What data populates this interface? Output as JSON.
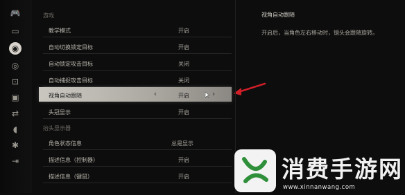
{
  "sidebar": {
    "icons": [
      {
        "name": "gamepad-icon",
        "glyph": "🎮"
      },
      {
        "name": "display-icon",
        "glyph": "▭"
      },
      {
        "name": "gameplay-icon",
        "glyph": "◉",
        "active": true
      },
      {
        "name": "eye-icon",
        "glyph": "◎"
      },
      {
        "name": "camera-icon",
        "glyph": "⊡"
      },
      {
        "name": "monitor-icon",
        "glyph": "▣"
      },
      {
        "name": "swap-icon",
        "glyph": "⇄"
      },
      {
        "name": "audio-icon",
        "glyph": "◖"
      },
      {
        "name": "accessibility-icon",
        "glyph": "✱"
      },
      {
        "name": "exit-icon",
        "glyph": "⇥"
      }
    ]
  },
  "sections": [
    {
      "header": "游戏"
    },
    {
      "header": "抬头显示器"
    }
  ],
  "settings": [
    {
      "label": "教学模式",
      "value": "开启"
    },
    {
      "label": "自动切换锁定目标",
      "value": "开启"
    },
    {
      "label": "自动锁定攻击目标",
      "value": "关闭"
    },
    {
      "label": "自动捕捉攻击目标",
      "value": "关闭"
    },
    {
      "label": "视角自动跟随",
      "value": "开启",
      "selected": true
    },
    {
      "label": "头冠显示",
      "value": "开启"
    },
    {
      "label": "角色状态信息",
      "value": "总是显示"
    },
    {
      "label": "描述信息（控制器）",
      "value": "开启"
    },
    {
      "label": "描述信息（键鼠）",
      "value": "开启"
    }
  ],
  "description": {
    "title": "视角自动跟随",
    "body": "开启后，当角色左右移动时，镜头会跟随旋转。"
  },
  "selector": {
    "left": "‹",
    "right": "›"
  },
  "watermark": {
    "text": "消费手游网",
    "url": "www.xinnanwang.com"
  },
  "colors": {
    "accent_red": "#d11f28",
    "watermark_green": "#2f8f3a"
  }
}
